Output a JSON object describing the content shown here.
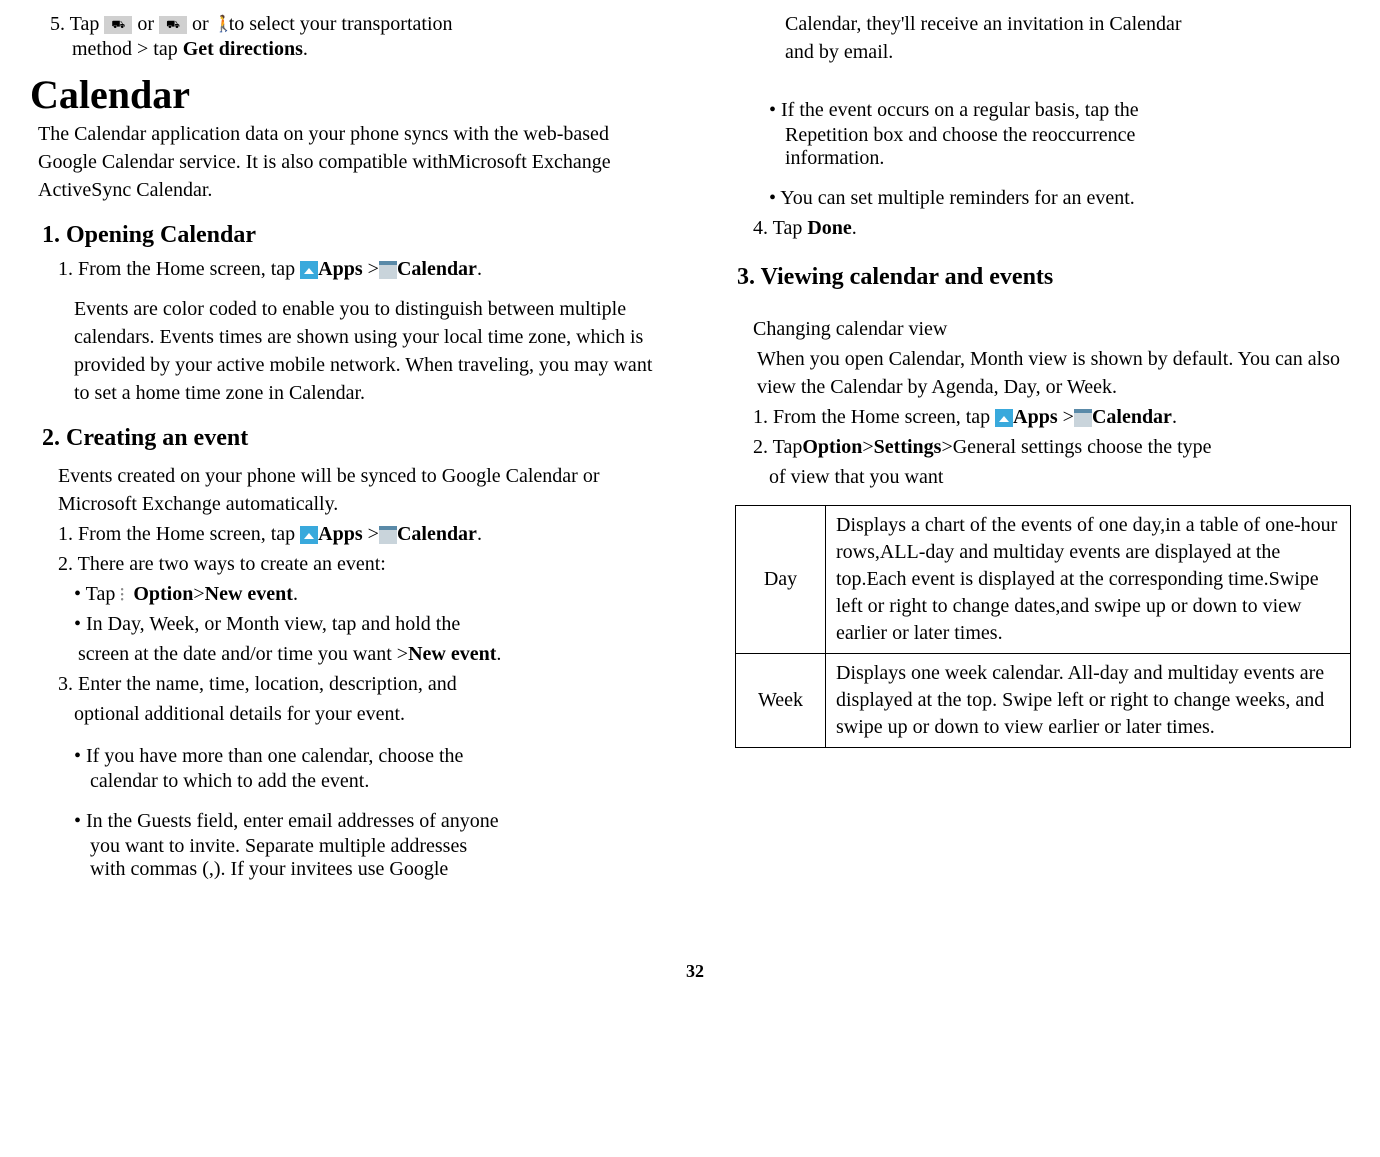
{
  "left": {
    "step5_a": "5. Tap ",
    "step5_b": "or ",
    "step5_c": "or",
    "step5_d": "to select your transportation",
    "step5_e": "method > tap ",
    "step5_f": "Get directions",
    "step5_g": ".",
    "h1": "Calendar",
    "intro": "The Calendar application data on your phone syncs with the web-based Google Calendar service. It is also compatible withMicrosoft Exchange ActiveSync Calendar.",
    "h2_1": "1. Opening Calendar",
    "open_1a": "1. From the Home screen, tap ",
    "apps": "Apps",
    "gt_cal": " >",
    "calendar": "Calendar",
    "dot": ".",
    "open_desc": "Events are color coded to enable you to distinguish between multiple calendars. Events times are shown using your local time zone, which is provided by your active mobile network. When traveling, you may want to set a home time zone in Calendar.",
    "h2_2": "2. Creating an event",
    "create_intro": "Events created on your phone will be synced to Google Calendar or Microsoft Exchange automatically.",
    "create_1": "1. From the Home screen, tap ",
    "create_2": "2. There are two ways to create an event:",
    "create_b1a": "• Tap",
    "create_b1b": "Option",
    "create_b1c": ">",
    "create_b1d": "New event",
    "create_b2a": "• In Day, Week, or Month view, tap and hold the",
    "create_b2b": "screen at the date and/or time you want >",
    "create_b2c": "New event",
    "create_3": "3. Enter the name, time, location, description, and",
    "create_3b": "optional additional details for your event.",
    "create_cal": "• If you have more than one calendar, choose the",
    "create_cal2": "calendar to which to add the event.",
    "create_guest": "• In the Guests field, enter email addresses of anyone",
    "create_guest2": "you want to invite. Separate multiple addresses",
    "create_guest3": "with commas (,). If your invitees use Google"
  },
  "right": {
    "cont1": "Calendar, they'll receive an invitation in Calendar",
    "cont2": "and by email.",
    "rep1": "• If the event occurs on a regular basis, tap the",
    "rep2": "Repetition box and choose the reoccurrence",
    "rep3": "information.",
    "rem": "• You can set multiple reminders for an event.",
    "done_a": "4. Tap ",
    "done_b": "Done",
    "h2_3": "3. Viewing calendar and events",
    "view_intro1": "Changing calendar view",
    "view_intro2": "When you open Calendar, Month view is shown by default. You can also view the Calendar by Agenda, Day, or Week.",
    "view_1": "1. From the Home screen, tap ",
    "view_2a": "2. Tap",
    "view_2b": "Option",
    "view_2c": ">",
    "view_2d": "Settings",
    "view_2e": ">General settings choose the type",
    "view_2f": "of view that you want",
    "table": {
      "day_label": "Day",
      "day_desc": "Displays a chart of the events of one day,in a table of one-hour rows,ALL-day and multiday events are displayed at the top.Each event is displayed at the corresponding time.Swipe left or right to change dates,and swipe up or down to view earlier or later times.",
      "week_label": "Week",
      "week_desc": "Displays one week calendar. All-day and multiday events are displayed at the top. Swipe left or right to change weeks, and swipe up or down to view earlier or later times."
    }
  },
  "page": "32"
}
